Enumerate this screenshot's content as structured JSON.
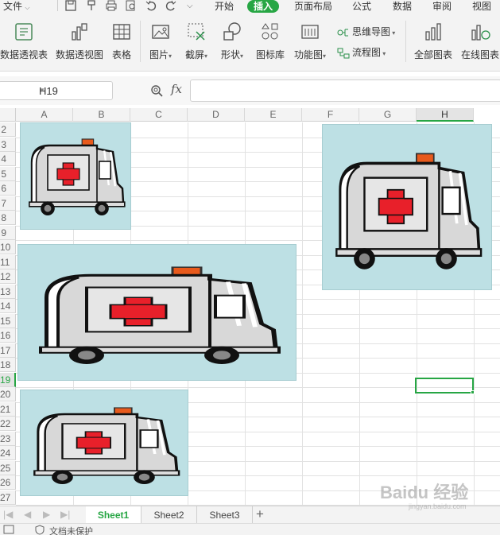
{
  "menu": {
    "file_label": "文件",
    "tabs": [
      "开始",
      "插入",
      "页面布局",
      "公式",
      "数据",
      "审阅",
      "视图"
    ],
    "active_tab": "插入"
  },
  "ribbon": {
    "pivot_table": "数据透视表",
    "pivot_chart": "数据透视图",
    "table": "表格",
    "picture": "图片",
    "screenshot": "截屏",
    "shapes": "形状",
    "icon_library": "图标库",
    "function_chart": "功能图",
    "mind_map": "思维导图",
    "flowchart": "流程图",
    "all_charts": "全部图表",
    "online_charts": "在线图表"
  },
  "formula_bar": {
    "name_box": "H19",
    "fx_label": "fx",
    "formula": ""
  },
  "grid": {
    "columns": [
      "A",
      "B",
      "C",
      "D",
      "E",
      "F",
      "G",
      "H"
    ],
    "rows": [
      "2",
      "3",
      "4",
      "5",
      "6",
      "7",
      "8",
      "9",
      "10",
      "11",
      "12",
      "13",
      "14",
      "15",
      "16",
      "17",
      "18",
      "19",
      "20",
      "21",
      "22",
      "23",
      "24",
      "25",
      "26",
      "27"
    ],
    "selected_column": "H",
    "selected_row": "19"
  },
  "sheets": {
    "tabs": [
      "Sheet1",
      "Sheet2",
      "Sheet3"
    ],
    "active": "Sheet1",
    "add_label": "+"
  },
  "status": {
    "protect_label": "文档未保护"
  },
  "watermark": {
    "brand": "Baidu 经验",
    "url": "jingyan.baidu.com"
  },
  "colors": {
    "accent": "#27a644",
    "picture_bg": "#bde0e4",
    "cross": "#e8202a",
    "siren": "#e85a1c"
  },
  "pictures": [
    {
      "name": "ambulance-picture-1",
      "icon": "ambulance"
    },
    {
      "name": "ambulance-picture-2",
      "icon": "ambulance"
    },
    {
      "name": "ambulance-picture-3",
      "icon": "ambulance"
    },
    {
      "name": "ambulance-picture-4",
      "icon": "ambulance"
    }
  ]
}
